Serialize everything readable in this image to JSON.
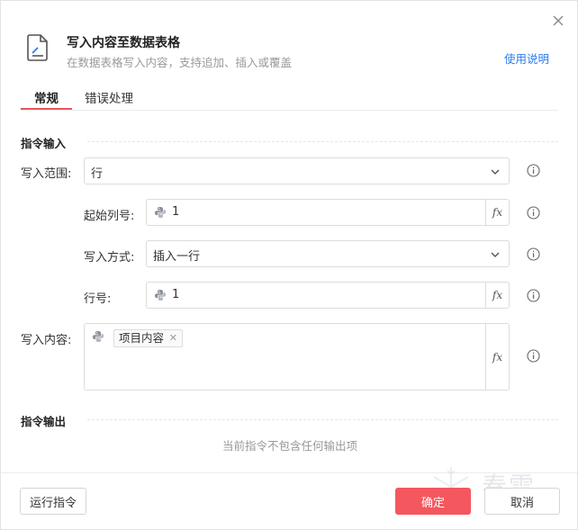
{
  "dialog": {
    "title": "写入内容至数据表格",
    "subtitle": "在数据表格写入内容，支持追加、插入或覆盖",
    "help_link": "使用说明"
  },
  "tabs": [
    {
      "label": "常规",
      "active": true
    },
    {
      "label": "错误处理",
      "active": false
    }
  ],
  "input_section": {
    "title": "指令输入",
    "write_range": {
      "label": "写入范围:",
      "value": "行"
    },
    "start_column": {
      "label": "起始列号:",
      "value": "1"
    },
    "write_mode": {
      "label": "写入方式:",
      "value": "插入一行"
    },
    "row_number": {
      "label": "行号:",
      "value": "1"
    },
    "content": {
      "label": "写入内容:",
      "tag": "项目内容"
    }
  },
  "output_section": {
    "title": "指令输出",
    "empty_text": "当前指令不包含任何输出项"
  },
  "footer": {
    "run_label": "运行指令",
    "confirm_label": "确定",
    "cancel_label": "取消"
  },
  "watermark": "春雪",
  "colors": {
    "accent": "#f5575e",
    "link": "#2a7cf0"
  }
}
